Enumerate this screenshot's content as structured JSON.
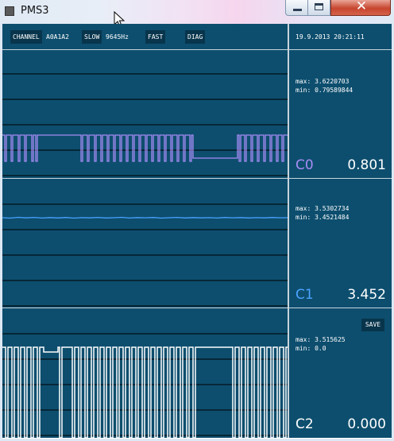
{
  "window": {
    "title": "PMS3",
    "buttons": {
      "minimize": "minimize",
      "maximize": "maximize",
      "close": "✕"
    }
  },
  "toolbar": {
    "channel_label": "CHANNEL",
    "channel_value": "A0A1A2",
    "slow_label": "SLOW",
    "frequency": "9645Hz",
    "fast_label": "FAST",
    "diag_label": "DIAG",
    "datetime": "19.9.2013 20:21:11"
  },
  "channels": [
    {
      "name": "C0",
      "max": "max: 3.6220703",
      "min": "min: 0.79589844",
      "value": "0.801",
      "color": "#a78cf5"
    },
    {
      "name": "C1",
      "max": "max: 3.5302734",
      "min": "min: 3.4521484",
      "value": "3.452",
      "color": "#4aa3ff"
    },
    {
      "name": "C2",
      "max": "max: 3.515625",
      "min": "min: 0.0",
      "value": "0.000",
      "color": "#ffffff"
    }
  ],
  "save_label": "SAVE",
  "icons": {
    "app": "app-icon",
    "cursor": "mouse-cursor-icon"
  },
  "colors": {
    "background": "#0d4e6e",
    "button": "#08354c",
    "separator": "#c8d4dc",
    "grid": "#000000"
  }
}
